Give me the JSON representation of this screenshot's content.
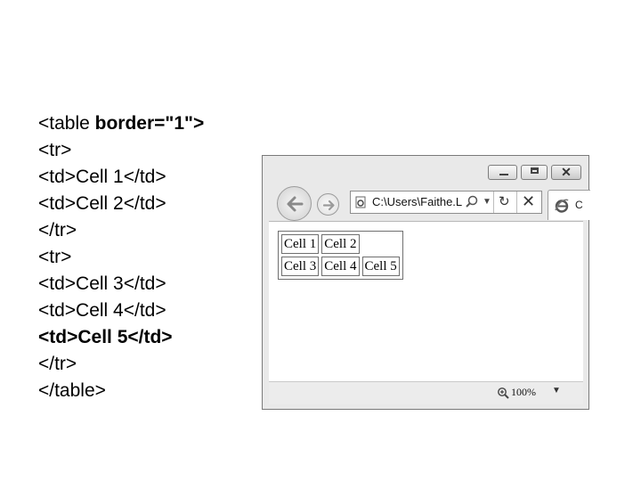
{
  "code_lines": [
    {
      "pre": "<table ",
      "bold": "border=\"1\">",
      "post": ""
    },
    {
      "pre": "<tr>",
      "bold": "",
      "post": ""
    },
    {
      "pre": "<td>Cell 1</td>",
      "bold": "",
      "post": ""
    },
    {
      "pre": "<td>Cell 2</td>",
      "bold": "",
      "post": ""
    },
    {
      "pre": "</tr>",
      "bold": "",
      "post": ""
    },
    {
      "pre": "<tr>",
      "bold": "",
      "post": ""
    },
    {
      "pre": "<td>Cell 3</td>",
      "bold": "",
      "post": ""
    },
    {
      "pre": "<td>Cell 4</td>",
      "bold": "",
      "post": ""
    },
    {
      "pre": "",
      "bold": "<td>Cell 5</td>",
      "post": ""
    },
    {
      "pre": "</tr>",
      "bold": "",
      "post": ""
    },
    {
      "pre": "</table>",
      "bold": "",
      "post": ""
    }
  ],
  "browser": {
    "window_buttons": {
      "minimize_icon": "minimize-icon",
      "maximize_icon": "maximize-icon",
      "close_label": "✕"
    },
    "nav": {
      "back_icon": "back-arrow-icon",
      "forward_icon": "forward-arrow-icon"
    },
    "address": {
      "url": "C:\\Users\\Faithe.L",
      "search_icon": "search-icon",
      "dropdown_icon": "dropdown-icon",
      "refresh_label": "↻",
      "stop_label": "✕"
    },
    "tab": {
      "label": "C",
      "icon": "ie-icon"
    },
    "demo_table": {
      "rows": [
        [
          "Cell 1",
          "Cell 2"
        ],
        [
          "Cell 3",
          "Cell 4",
          "Cell 5"
        ]
      ]
    },
    "status": {
      "zoom": "100%",
      "zoom_icon": "zoom-icon"
    }
  }
}
